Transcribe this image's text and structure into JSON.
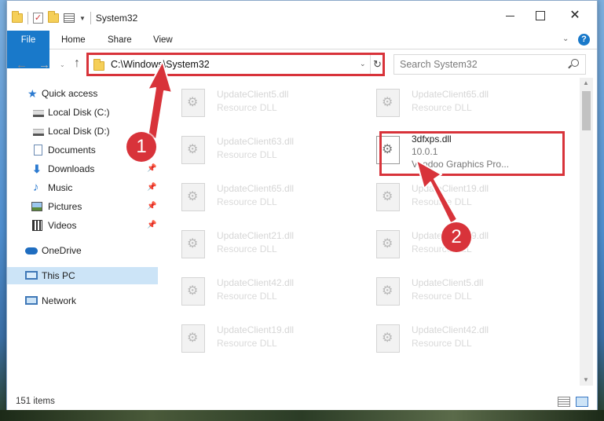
{
  "window": {
    "title": "System32",
    "controls": {
      "minimize": "minimize",
      "maximize": "maximize",
      "close": "✕"
    }
  },
  "ribbon": {
    "tabs": [
      {
        "label": "File"
      },
      {
        "label": "Home"
      },
      {
        "label": "Share"
      },
      {
        "label": "View"
      }
    ],
    "help": "?"
  },
  "navigation": {
    "address": "C:\\Windows\\System32",
    "search_placeholder": "Search System32"
  },
  "sidebar": {
    "items": [
      {
        "label": "Quick access",
        "icon": "star-icon"
      },
      {
        "label": "Local Disk (C:)",
        "icon": "disk-icon"
      },
      {
        "label": "Local Disk (D:)",
        "icon": "disk-icon"
      },
      {
        "label": "Documents",
        "icon": "documents-icon"
      },
      {
        "label": "Downloads",
        "icon": "download-icon",
        "pinned": true
      },
      {
        "label": "Music",
        "icon": "music-icon",
        "pinned": true
      },
      {
        "label": "Pictures",
        "icon": "pictures-icon",
        "pinned": true
      },
      {
        "label": "Videos",
        "icon": "videos-icon",
        "pinned": true
      },
      {
        "label": "OneDrive",
        "icon": "cloud-icon"
      },
      {
        "label": "This PC",
        "icon": "computer-icon",
        "selected": true
      },
      {
        "label": "Network",
        "icon": "network-icon"
      }
    ]
  },
  "files": [
    {
      "name": "UpdateClient5.dll",
      "type": "Resource DLL"
    },
    {
      "name": "UpdateClient65.dll",
      "type": "Resource DLL"
    },
    {
      "name": "UpdateClient63.dll",
      "type": "Resource DLL"
    },
    {
      "name": "3dfxps.dll",
      "version": "10.0.1",
      "type": "Voodoo Graphics Pro...",
      "highlighted": true
    },
    {
      "name": "UpdateClient65.dll",
      "type": "Resource DLL"
    },
    {
      "name": "UpdateClient19.dll",
      "type": "Resource DLL"
    },
    {
      "name": "UpdateClient21.dll",
      "type": "Resource DLL"
    },
    {
      "name": "UpdateClient19.dll",
      "type": "Resource DLL"
    },
    {
      "name": "UpdateClient42.dll",
      "type": "Resource DLL"
    },
    {
      "name": "UpdateClient5.dll",
      "type": "Resource DLL"
    },
    {
      "name": "UpdateClient19.dll",
      "type": "Resource DLL"
    },
    {
      "name": "UpdateClient42.dll",
      "type": "Resource DLL"
    }
  ],
  "status": {
    "item_count": "151 items"
  },
  "annotations": {
    "step1": "1",
    "step2": "2",
    "color": "#d8333a"
  }
}
